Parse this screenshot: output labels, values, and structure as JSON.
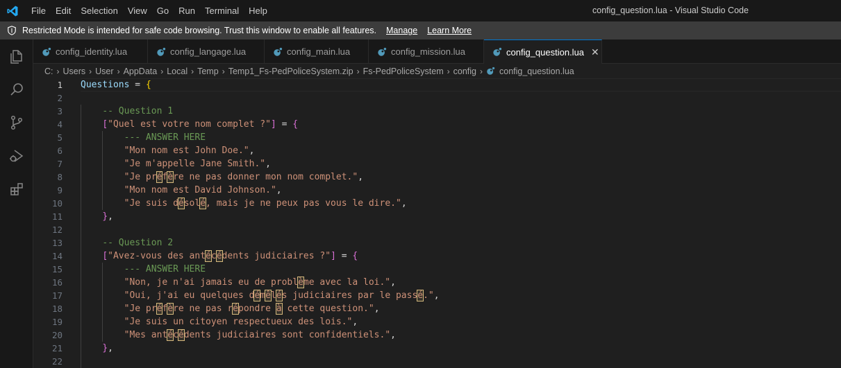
{
  "titlebar": {
    "menu": [
      "File",
      "Edit",
      "Selection",
      "View",
      "Go",
      "Run",
      "Terminal",
      "Help"
    ],
    "window_title": "config_question.lua - Visual Studio Code"
  },
  "banner": {
    "message": "Restricted Mode is intended for safe code browsing. Trust this window to enable all features.",
    "manage": "Manage",
    "learn_more": "Learn More"
  },
  "activity_bar": [
    "explorer-icon",
    "search-icon",
    "source-control-icon",
    "run-debug-icon",
    "extensions-icon"
  ],
  "tabs": [
    {
      "label": "config_identity.lua",
      "active": false
    },
    {
      "label": "config_langage.lua",
      "active": false
    },
    {
      "label": "config_main.lua",
      "active": false
    },
    {
      "label": "config_mission.lua",
      "active": false
    },
    {
      "label": "config_question.lua",
      "active": true
    }
  ],
  "breadcrumb": [
    "C:",
    "Users",
    "User",
    "AppData",
    "Local",
    "Temp",
    "Temp1_Fs-PedPoliceSystem.zip",
    "Fs-PedPoliceSystem",
    "config",
    "config_question.lua"
  ],
  "editor": {
    "line_numbers": [
      "1",
      "2",
      "3",
      "4",
      "5",
      "6",
      "7",
      "8",
      "9",
      "10",
      "11",
      "12",
      "13",
      "14",
      "15",
      "16",
      "17",
      "18",
      "19",
      "20",
      "21",
      "22"
    ],
    "current_line": "1",
    "lines": [
      "Questions = {",
      "",
      "    -- Question 1",
      "    [\"Quel est votre nom complet ?\"] = {",
      "        --- ANSWER HERE",
      "        \"Mon nom est John Doe.\",",
      "        \"Je m'appelle Jane Smith.\",",
      "        \"Je préfère ne pas donner mon nom complet.\",",
      "        \"Mon nom est David Johnson.\",",
      "        \"Je suis désolé, mais je ne peux pas vous le dire.\",",
      "    },",
      "",
      "    -- Question 2",
      "    [\"Avez-vous des antécédents judiciaires ?\"] = {",
      "        --- ANSWER HERE",
      "        \"Non, je n'ai jamais eu de problème avec la loi.\",",
      "        \"Oui, j'ai eu quelques démêlés judiciaires par le passé.\",",
      "        \"Je préfère ne pas répondre à cette question.\",",
      "        \"Je suis un citoyen respectueux des lois.\",",
      "        \"Mes antécédents judiciaires sont confidentiels.\",",
      "    },",
      ""
    ]
  },
  "colors": {
    "accent": "#0078d4",
    "lua_icon": "#519aba",
    "string": "#ce9178",
    "comment": "#6a9955",
    "variable": "#9cdcfe"
  }
}
